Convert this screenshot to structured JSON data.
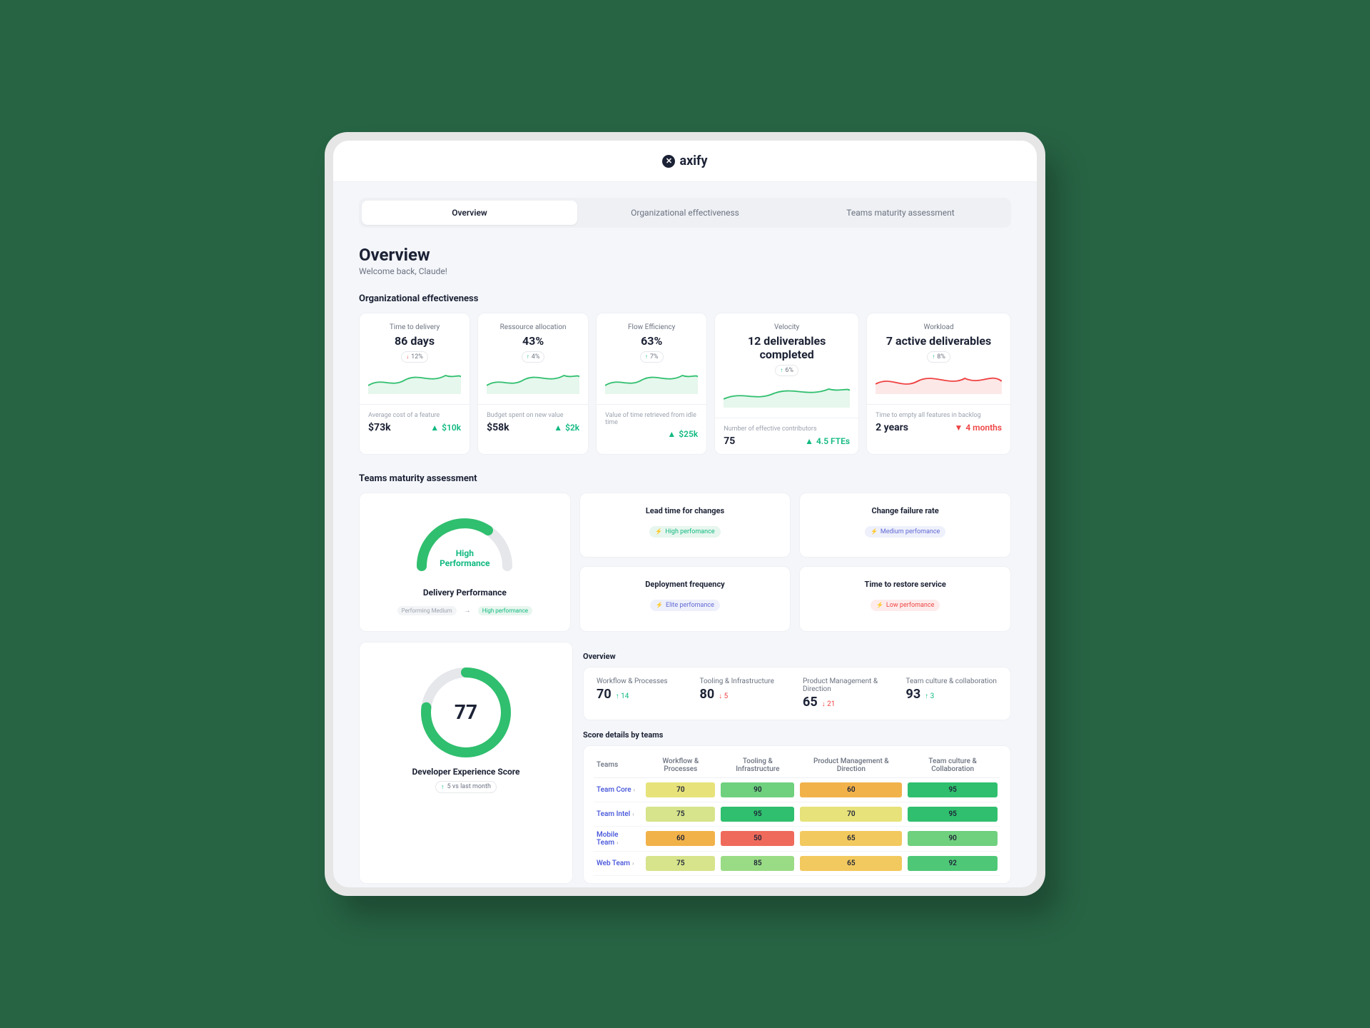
{
  "brand": "axify",
  "tabs": [
    "Overview",
    "Organizational effectiveness",
    "Teams maturity assessment"
  ],
  "page": {
    "title": "Overview",
    "welcome": "Welcome back, Claude!"
  },
  "sections": {
    "org": "Organizational effectiveness",
    "maturity": "Teams maturity assessment"
  },
  "metrics": [
    {
      "label": "Time to delivery",
      "value": "86 days",
      "delta": "12%",
      "dir": "down",
      "sub_label": "Average cost of a feature",
      "sub_v1": "$73k",
      "sub_v2": "$10k",
      "sub_dir": "up",
      "spark": "green"
    },
    {
      "label": "Ressource allocation",
      "value": "43%",
      "delta": "4%",
      "dir": "up",
      "sub_label": "Budget spent on new value",
      "sub_v1": "$58k",
      "sub_v2": "$2k",
      "sub_dir": "up",
      "spark": "green"
    },
    {
      "label": "Flow Efficiency",
      "value": "63%",
      "delta": "7%",
      "dir": "up",
      "sub_label": "Value of time retrieved from idle time",
      "sub_v1": "",
      "sub_v2": "$25k",
      "sub_dir": "up",
      "spark": "green"
    },
    {
      "label": "Velocity",
      "value": "12 deliverables completed",
      "delta": "6%",
      "dir": "up",
      "sub_label": "Number of effective contributors",
      "sub_v1": "75",
      "sub_v2": "4.5 FTEs",
      "sub_dir": "up",
      "spark": "green"
    },
    {
      "label": "Workload",
      "value": "7 active deliverables",
      "delta": "8%",
      "dir": "up",
      "sub_label": "Time to empty all features in backlog",
      "sub_v1": "2 years",
      "sub_v2": "4 months",
      "sub_dir": "down",
      "spark": "red"
    }
  ],
  "delivery_performance": {
    "title": "Delivery Performance",
    "gauge_label": "High\nPerformance",
    "from_pill": "Performing Medium",
    "to_pill": "High performance"
  },
  "dora": [
    {
      "title": "Lead time for changes",
      "level": "high",
      "text": "High perfomance"
    },
    {
      "title": "Change failure rate",
      "level": "medium",
      "text": "Medium perfomance"
    },
    {
      "title": "Deployment frequency",
      "level": "elite",
      "text": "Elite perfomance"
    },
    {
      "title": "Time to restore service",
      "level": "low",
      "text": "Low perfomance"
    }
  ],
  "devx": {
    "score": "77",
    "title": "Developer Experience Score",
    "delta": "5 vs last month",
    "overview_heading": "Overview",
    "overview": [
      {
        "label": "Workflow & Processes",
        "value": "70",
        "delta": "14",
        "dir": "up"
      },
      {
        "label": "Tooling & Infrastructure",
        "value": "80",
        "delta": "5",
        "dir": "down"
      },
      {
        "label": "Product Management & Direction",
        "value": "65",
        "delta": "21",
        "dir": "down"
      },
      {
        "label": "Team culture & collaboration",
        "value": "93",
        "delta": "3",
        "dir": "up"
      }
    ],
    "table_heading": "Score details by teams",
    "columns": [
      "Teams",
      "Workflow & Processes",
      "Tooling & Infrastructure",
      "Product Management & Direction",
      "Team culture & Collaboration"
    ],
    "rows": [
      {
        "team": "Team Core",
        "cells": [
          70,
          90,
          60,
          95
        ]
      },
      {
        "team": "Team Intel",
        "cells": [
          75,
          95,
          70,
          95
        ]
      },
      {
        "team": "Mobile Team",
        "cells": [
          60,
          50,
          65,
          90
        ]
      },
      {
        "team": "Web Team",
        "cells": [
          75,
          85,
          65,
          92
        ]
      }
    ]
  },
  "heatmap_colors": {
    "50": "#ef6a5a",
    "60": "#f2b24a",
    "65": "#f2c95e",
    "70": "#e7e27a",
    "75": "#d7e48b",
    "80": "#b9e089",
    "85": "#9adb85",
    "90": "#6fd07e",
    "92": "#4ec877",
    "95": "#2fbf6e"
  },
  "chart_data": {
    "type": "table",
    "title": "Score details by teams",
    "columns": [
      "Teams",
      "Workflow & Processes",
      "Tooling & Infrastructure",
      "Product Management & Direction",
      "Team culture & Collaboration"
    ],
    "rows": [
      [
        "Team Core",
        70,
        90,
        60,
        95
      ],
      [
        "Team Intel",
        75,
        95,
        70,
        95
      ],
      [
        "Mobile Team",
        60,
        50,
        65,
        90
      ],
      [
        "Web Team",
        75,
        85,
        65,
        92
      ]
    ]
  }
}
